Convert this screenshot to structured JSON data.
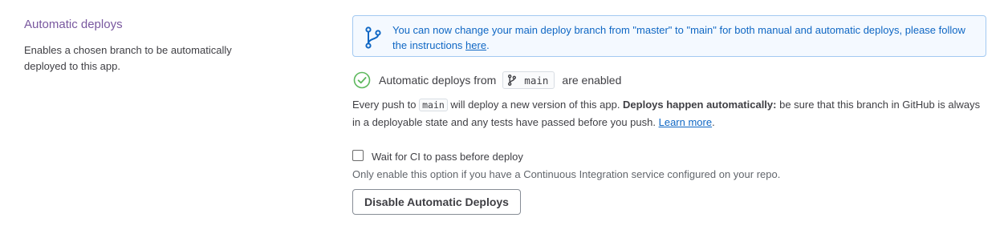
{
  "section": {
    "title": "Automatic deploys",
    "description": "Enables a chosen branch to be automatically deployed to this app."
  },
  "banner": {
    "icon": "git-branch-icon",
    "text": "You can now change your main deploy branch from \"master\" to \"main\" for both manual and automatic deploys, please follow the instructions ",
    "link": "here",
    "suffix": "."
  },
  "status": {
    "icon": "check-circle-icon",
    "prefix": "Automatic deploys from",
    "branch": "main",
    "suffix": "are enabled"
  },
  "info": {
    "part1": "Every push to ",
    "branch": "main",
    "part2": " will deploy a new version of this app. ",
    "bold": "Deploys happen automatically:",
    "part3": " be sure that this branch in GitHub is always in a deployable state and any tests have passed before you push. ",
    "link": "Learn more",
    "end": "."
  },
  "ci": {
    "label": "Wait for CI to pass before deploy",
    "checked": false,
    "hint": "Only enable this option if you have a Continuous Integration service configured on your repo."
  },
  "actions": {
    "disable_label": "Disable Automatic Deploys"
  },
  "colors": {
    "accent": "#79589f",
    "link": "#0f67c4",
    "success": "#5cb85c",
    "banner_bg": "#f4f9ff",
    "banner_border": "#a3c9f1"
  }
}
